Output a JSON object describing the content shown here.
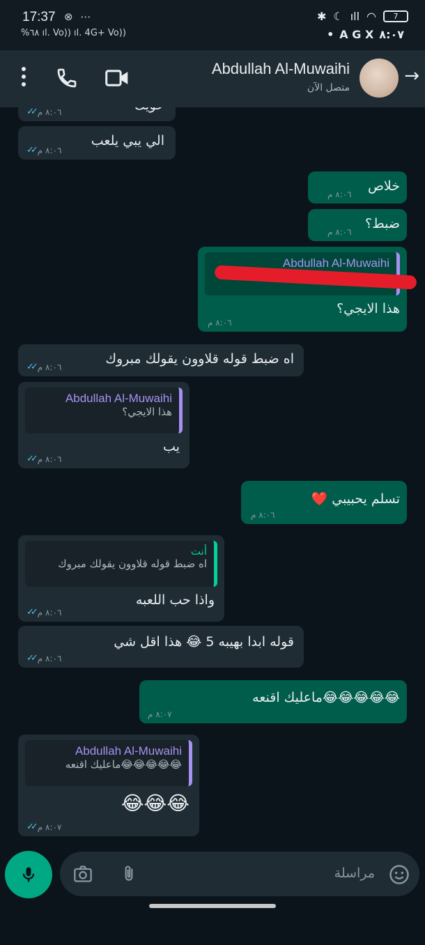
{
  "status_bar": {
    "time": "17:37",
    "left_icons": "⊗ ⋯",
    "row2_left": "%٦٨ ıl. Vo)) ıl. 4G+ Vo))",
    "right_clock": "٨:٠٧",
    "right_icons": "A G X",
    "battery": "7"
  },
  "header": {
    "contact_name": "Abdullah Al-Muwaihi",
    "status": "متصل الآن"
  },
  "messages": [
    {
      "id": "m0",
      "dir": "in",
      "text": "خويك",
      "time": "٨:٠٦ م"
    },
    {
      "id": "m1",
      "dir": "in",
      "text": "الي يبي يلعب",
      "time": "٨:٠٦ م"
    },
    {
      "id": "m2",
      "dir": "out",
      "text": "خلاص",
      "time": "٨:٠٦ م"
    },
    {
      "id": "m3",
      "dir": "out",
      "text": "ضبط؟",
      "time": "٨:٠٦ م"
    },
    {
      "id": "m4",
      "dir": "out",
      "quote_name": "Abdullah Al-Muwaihi",
      "text": "هذا الايجي؟",
      "time": "٨:٠٦ م"
    },
    {
      "id": "m5",
      "dir": "in",
      "text": "اه ضبط قوله قلاوون يقولك مبروك",
      "time": "٨:٠٦ م"
    },
    {
      "id": "m6",
      "dir": "in",
      "quote_name": "Abdullah Al-Muwaihi",
      "quote_text": "هذا الايجي؟",
      "text": "يب",
      "time": "٨:٠٦ م"
    },
    {
      "id": "m7",
      "dir": "out",
      "text": "تسلم يحبيبي ❤️",
      "time": "٨:٠٦ م"
    },
    {
      "id": "m8",
      "dir": "in",
      "quote_name": "أنت",
      "quote_text": "اه ضبط قوله قلاوون يقولك مبروك",
      "text": "واذا حب اللعبه",
      "time": "٨:٠٦ م"
    },
    {
      "id": "m9",
      "dir": "in",
      "text": "قوله ابدا بهيبه 5 😂 هذا اقل شي",
      "time": "٨:٠٦ م"
    },
    {
      "id": "m10",
      "dir": "out",
      "text": "😂😂😂😂😂ماعليك اقنعه",
      "time": "٨:٠٧ م"
    },
    {
      "id": "m11",
      "dir": "in",
      "quote_name": "Abdullah Al-Muwaihi",
      "quote_text": "😂😂😂😂😂ماعليك اقنعه",
      "text": "😂😂😂",
      "time": "٨:٠٧ م"
    }
  ],
  "input": {
    "placeholder": "مراسلة"
  },
  "colors": {
    "incoming_bubble": "#1f2c34",
    "outgoing_bubble": "#005c4b",
    "accent": "#00a884",
    "read_ticks": "#53bdeb",
    "quote_name": "#a791f0",
    "redaction": "#e51d2a"
  }
}
